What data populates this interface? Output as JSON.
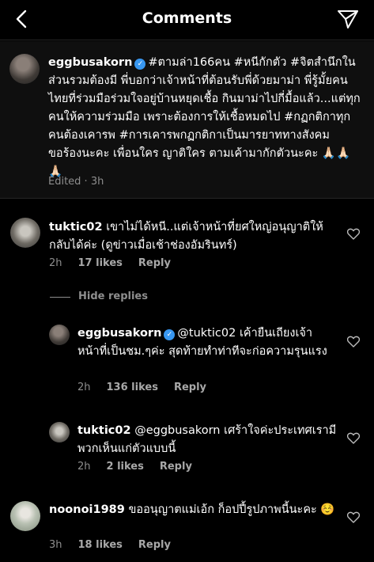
{
  "header": {
    "title": "Comments",
    "back_icon": "chevron-left-icon",
    "send_icon": "paper-plane-icon"
  },
  "caption": {
    "username": "eggbusakorn",
    "text": "#ตามล่า166คน #หนีกักตัว #จิตสำนึกในส่วนรวมต้องมี พี่บอกว่าเจ้าหน้าที่ต้อนรับพี่ด้วยมาม่า พี่รู้มั้ยคนไทยที่ร่วมมือร่วมใจอยู่บ้านหยุดเชื้อ กินมาม่าไปกี่มื้อแล้ว...แต่ทุกคนให้ความร่วมมือ เพราะต้องการให้เชื้อหมดไป #กฏกติกาทุกคนต้องเคารพ #การเคารพกฏกติกาเป็นมารยาททางสังคม ขอร้องนะคะ เพื่อนใคร ญาติใคร ตามเค้ามากักตัวนะคะ 🙏🏻🙏🏻🙏🏻",
    "meta": "Edited · 3h"
  },
  "comments": [
    {
      "username": "tuktic02",
      "text": "เขาไม่ได้หนี..แต่เจ้าหน้าที่ยศใหญ่อนุญาติให้กลับได้ค่ะ (ดูข่าวเมื่อเช้าช่องอัมรินทร์)",
      "time": "2h",
      "likes": "17 likes",
      "reply": "Reply"
    },
    {
      "username": "noonoi1989",
      "text": "ขออนุญาตแม่เอ้ก ก็อปปี้รูปภาพนี้นะคะ ☺️",
      "time": "3h",
      "likes": "18 likes",
      "reply": "Reply"
    }
  ],
  "hide_replies": "Hide replies",
  "replies": [
    {
      "username": "eggbusakorn",
      "mention": "@tuktic02",
      "text": "เค้ายืนเถียงเจ้าหน้าที่เป็นชม.ๆค่ะ สุดท้ายทำท่าทีจะก่อความรุนแรง",
      "time": "2h",
      "likes": "136 likes",
      "reply": "Reply"
    },
    {
      "username": "tuktic02",
      "mention": "@eggbusakorn",
      "text": "เศร้าใจค่ะประเทศเรามีพวกเห็นแก่ตัวแบบนี้",
      "time": "2h",
      "likes": "2 likes",
      "reply": "Reply"
    }
  ],
  "colors": {
    "accent": "#3897f0",
    "background": "#000000",
    "muted": "#8e8e8e"
  }
}
